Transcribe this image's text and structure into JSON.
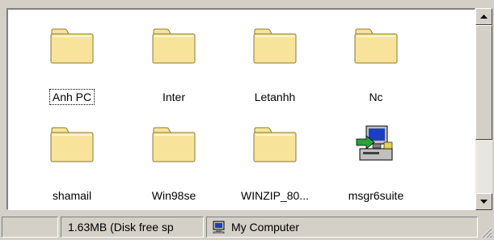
{
  "files": [
    {
      "name": "Anh PC",
      "icon": "folder-icon",
      "focused": true
    },
    {
      "name": "Inter",
      "icon": "folder-icon",
      "focused": false
    },
    {
      "name": "Letanhh",
      "icon": "folder-icon",
      "focused": false
    },
    {
      "name": "Nc",
      "icon": "folder-icon",
      "focused": false
    },
    {
      "name": "shamail",
      "icon": "folder-icon",
      "focused": false
    },
    {
      "name": "Win98se",
      "icon": "folder-icon",
      "focused": false
    },
    {
      "name": "WINZIP_80...",
      "icon": "folder-icon",
      "focused": false
    },
    {
      "name": "msgr6suite",
      "icon": "installer-icon",
      "focused": false
    }
  ],
  "statusbar": {
    "disk_info": "1.63MB (Disk free sp",
    "location": "My Computer"
  },
  "colors": {
    "folder_fill": "#f7e39a",
    "folder_stroke": "#8a7a3a",
    "chrome": "#d4d0c8"
  }
}
